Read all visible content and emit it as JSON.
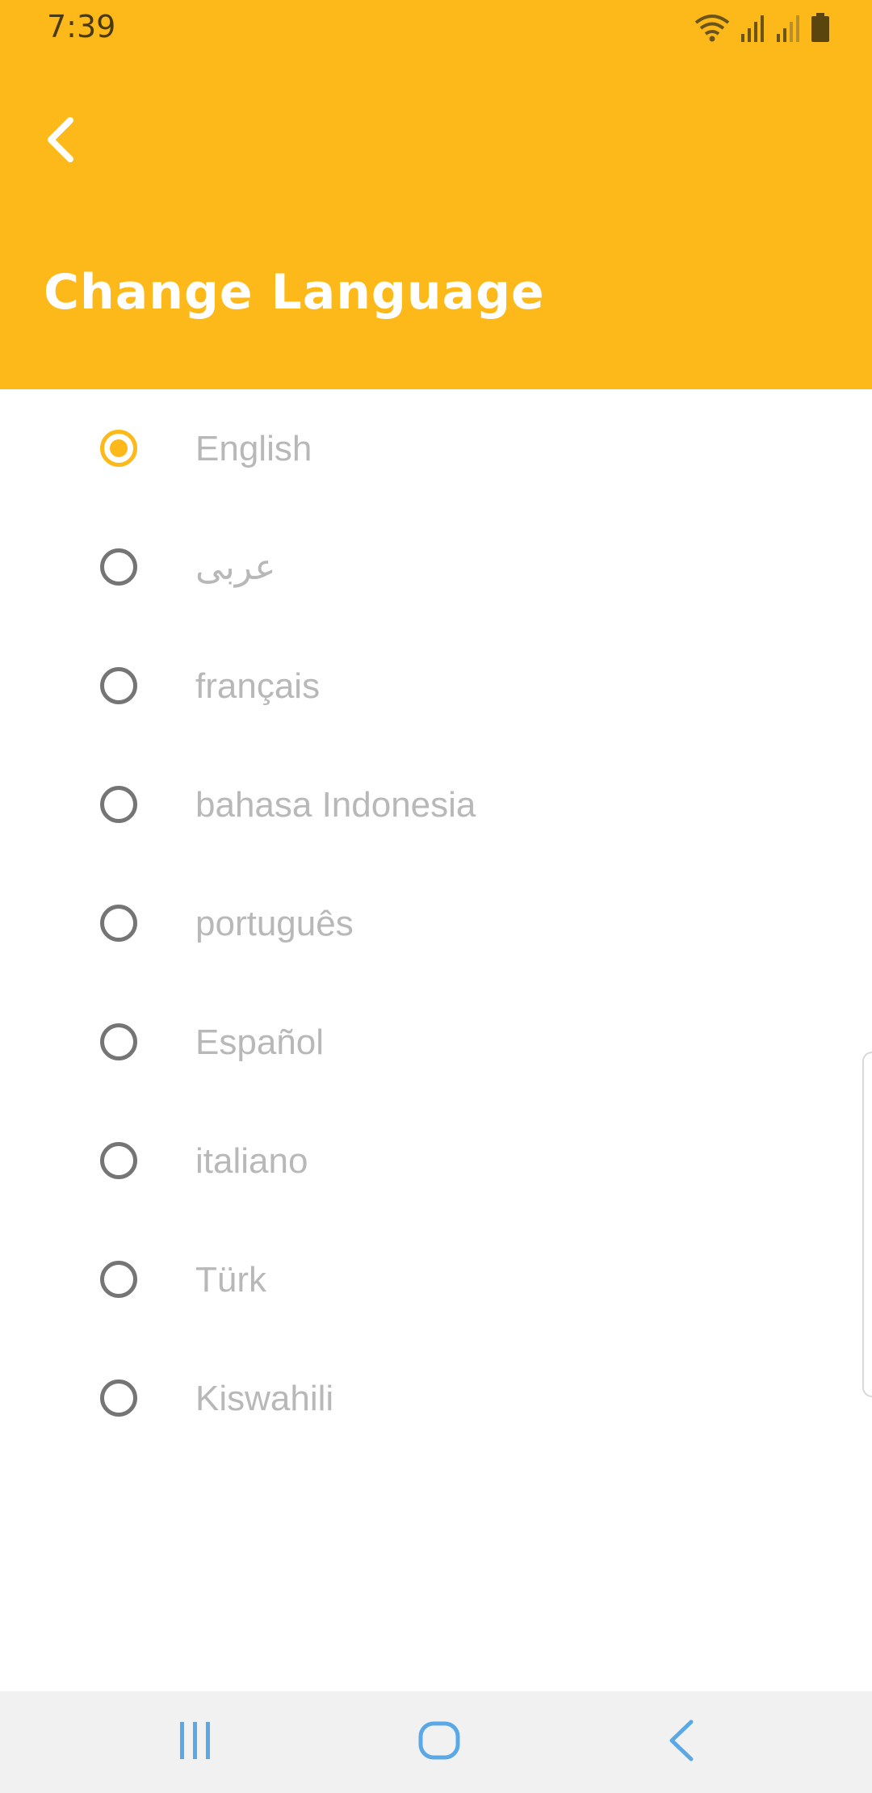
{
  "status_bar": {
    "time": "7:39",
    "icons": [
      "wifi-icon",
      "signal-icon",
      "signal-icon",
      "battery-icon"
    ]
  },
  "header": {
    "back_icon": "chevron-left-icon",
    "title": "Change Language",
    "background_color": "#FDB81A"
  },
  "languages": {
    "selected_index": 0,
    "items": [
      {
        "label": "English",
        "selected": true
      },
      {
        "label": "عربى",
        "selected": false
      },
      {
        "label": "français",
        "selected": false
      },
      {
        "label": "bahasa Indonesia",
        "selected": false
      },
      {
        "label": "português",
        "selected": false
      },
      {
        "label": "Español",
        "selected": false
      },
      {
        "label": "italiano",
        "selected": false
      },
      {
        "label": "Türk",
        "selected": false
      },
      {
        "label": "Kiswahili",
        "selected": false
      }
    ]
  },
  "nav_bar": {
    "buttons": [
      "recent-apps-icon",
      "home-icon",
      "back-icon"
    ],
    "icon_color": "#5aa9e6"
  }
}
